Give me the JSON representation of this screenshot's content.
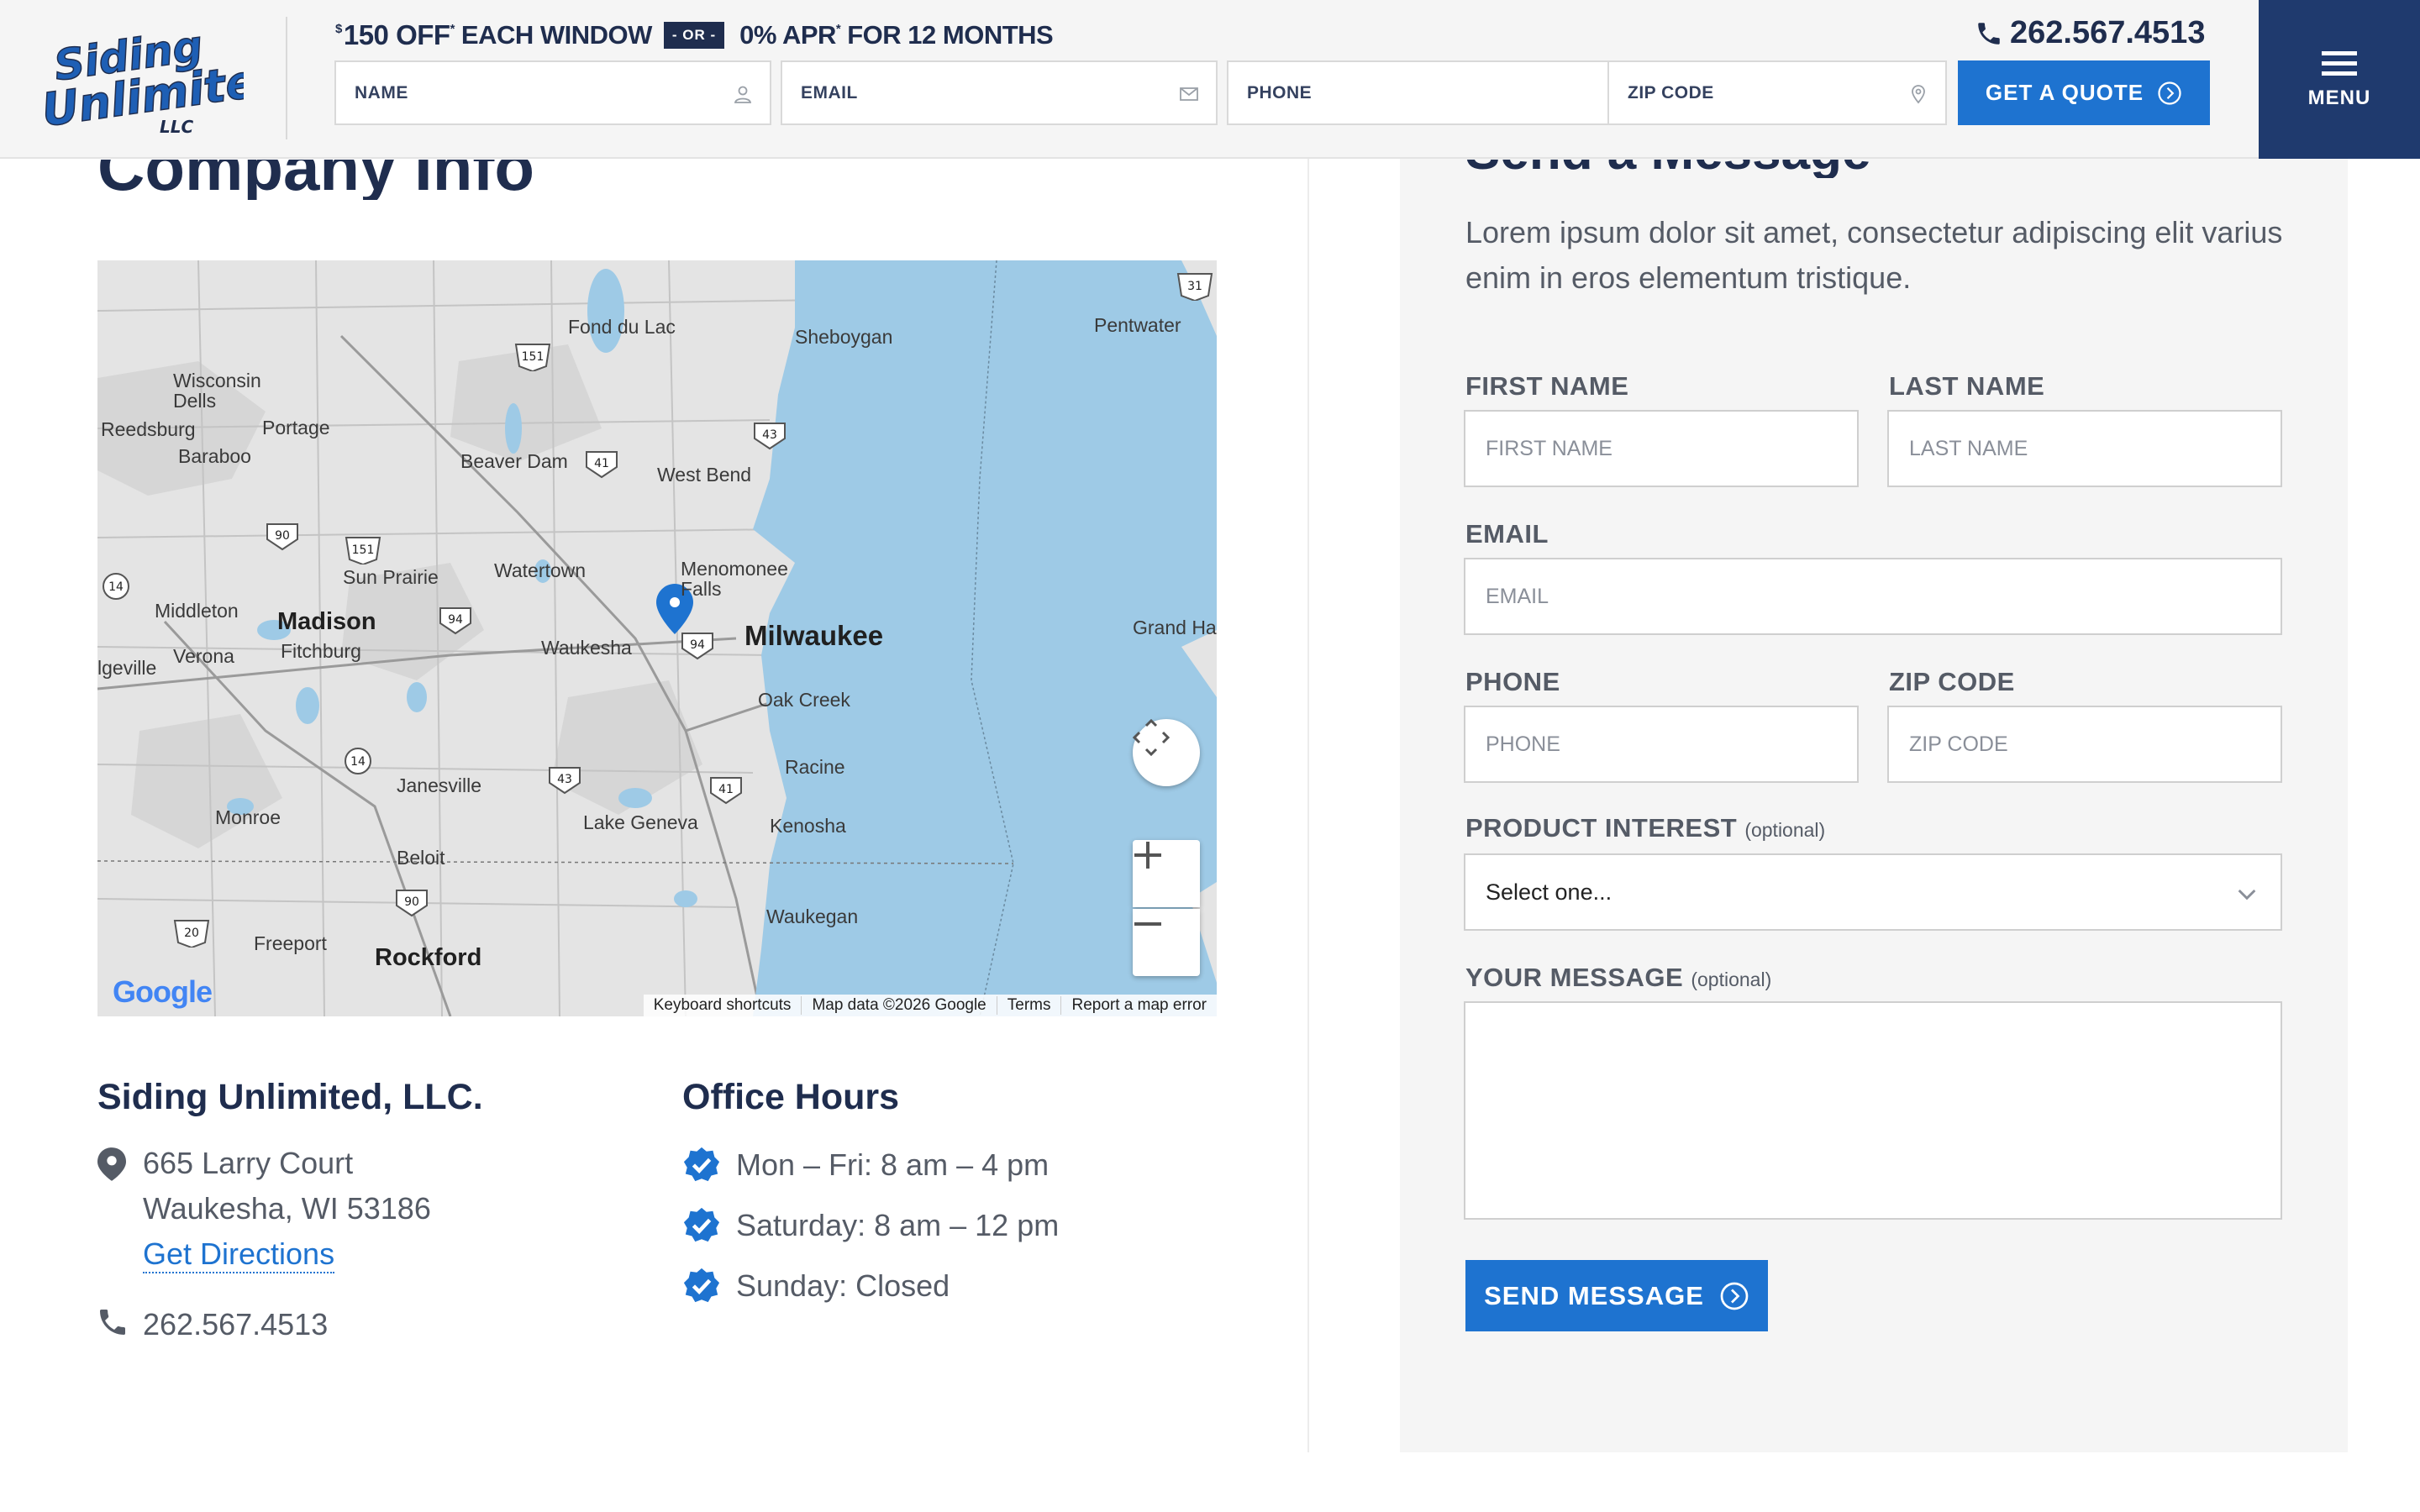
{
  "header": {
    "logo_text": [
      "Siding",
      "Unlimited",
      "LLC"
    ],
    "promo": {
      "currency": "$",
      "amount": "150 OFF",
      "mark": "*",
      "each_window": "EACH WINDOW",
      "or": "- OR -",
      "apr": "0% APR",
      "apr_mark": "*",
      "apr_term": "FOR 12 MONTHS"
    },
    "fields": {
      "name_placeholder": "NAME",
      "email_placeholder": "EMAIL",
      "phone_placeholder": "PHONE",
      "zip_placeholder": "ZIP CODE"
    },
    "phone": "262.567.4513",
    "quote_button": "GET A QUOTE",
    "menu_label": "MENU"
  },
  "company": {
    "title": "Company Info",
    "name": "Siding Unlimited, LLC.",
    "address_line1": "665 Larry Court",
    "address_line2": "Waukesha, WI 53186",
    "directions_link": "Get Directions",
    "phone": "262.567.4513"
  },
  "hours": {
    "title": "Office Hours",
    "items": [
      "Mon – Fri: 8 am – 4 pm",
      "Saturday: 8 am – 12 pm",
      "Sunday: Closed"
    ]
  },
  "map": {
    "cities": {
      "fond_du_lac": "Fond du Lac",
      "sheboygan": "Sheboygan",
      "pentwater": "Pentwater",
      "wisconsin_dells": "Wisconsin Dells",
      "wisconsin": "Wisconsin",
      "dells": "Dells",
      "reedsburg": "Reedsburg",
      "portage": "Portage",
      "baraboo": "Baraboo",
      "beaver_dam": "Beaver Dam",
      "west_bend": "West Bend",
      "sun_prairie": "Sun Prairie",
      "watertown": "Watertown",
      "menomonee": "Menomonee",
      "falls": "Falls",
      "middleton": "Middleton",
      "madison": "Madison",
      "milwaukee": "Milwaukee",
      "grand_haven": "Grand Ha",
      "verona": "Verona",
      "fitchburg": "Fitchburg",
      "waukesha": "Waukesha",
      "edgeville": "lgeville",
      "oak_creek": "Oak Creek",
      "racine": "Racine",
      "janesville": "Janesville",
      "monroe": "Monroe",
      "lake_geneva": "Lake Geneva",
      "kenosha": "Kenosha",
      "beloit": "Beloit",
      "waukegan": "Waukegan",
      "freeport": "Freeport",
      "rockford": "Rockford"
    },
    "shields": [
      "151",
      "41",
      "43",
      "90",
      "151",
      "14",
      "94",
      "94",
      "14",
      "43",
      "41",
      "90",
      "20",
      "31"
    ],
    "google_logo": "Google",
    "footer": [
      "Keyboard shortcuts",
      "Map data ©2026 Google",
      "Terms",
      "Report a map error"
    ]
  },
  "form": {
    "title": "Send a Message",
    "description": "Lorem ipsum dolor sit amet, consectetur adipiscing elit varius enim in eros elementum tristique.",
    "first_name_label": "FIRST NAME",
    "first_name_placeholder": "FIRST NAME",
    "last_name_label": "LAST NAME",
    "last_name_placeholder": "LAST NAME",
    "email_label": "EMAIL",
    "email_placeholder": "EMAIL",
    "phone_label": "PHONE",
    "phone_placeholder": "PHONE",
    "zip_label": "ZIP CODE",
    "zip_placeholder": "ZIP CODE",
    "product_label": "PRODUCT INTEREST",
    "optional": "(optional)",
    "product_selected": "Select one...",
    "message_label": "YOUR MESSAGE",
    "send_button": "SEND MESSAGE"
  },
  "colors": {
    "navy": "#1f2d4e",
    "brand_blue": "#1e73d0",
    "menu_bg": "#1f3a6e",
    "water": "#9ecae6"
  }
}
